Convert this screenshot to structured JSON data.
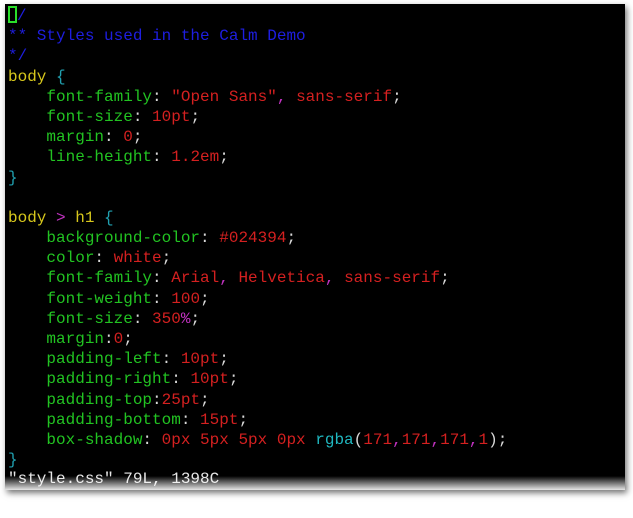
{
  "colors": {
    "background": "#000000",
    "comment": "#1e1ee0",
    "selector": "#d7c71c",
    "brace": "#20a0b0",
    "combinator": "#c032c0",
    "property": "#22c322",
    "value": "#d42020",
    "punct": "#d9d9d9",
    "function": "#20b8c0",
    "cursor": "#2adf2a",
    "status": "#e6e6e6"
  },
  "editor": {
    "lines": [
      {
        "kind": "cursor",
        "tokens": [
          {
            "t": "/",
            "c": "comment"
          }
        ]
      },
      {
        "tokens": [
          {
            "t": "** Styles used in the Calm Demo",
            "c": "comment"
          }
        ]
      },
      {
        "tokens": [
          {
            "t": "*/",
            "c": "comment"
          }
        ]
      },
      {
        "tokens": [
          {
            "t": "body",
            "c": "selector"
          },
          {
            "t": " ",
            "c": "punct"
          },
          {
            "t": "{",
            "c": "brace"
          }
        ]
      },
      {
        "tokens": [
          {
            "t": "    ",
            "c": "punct"
          },
          {
            "t": "font-family",
            "c": "property"
          },
          {
            "t": ": ",
            "c": "punct"
          },
          {
            "t": "\"Open Sans\"",
            "c": "value"
          },
          {
            "t": ", ",
            "c": "combinator"
          },
          {
            "t": "sans-serif",
            "c": "value"
          },
          {
            "t": ";",
            "c": "punct"
          }
        ]
      },
      {
        "tokens": [
          {
            "t": "    ",
            "c": "punct"
          },
          {
            "t": "font-size",
            "c": "property"
          },
          {
            "t": ": ",
            "c": "punct"
          },
          {
            "t": "10pt",
            "c": "value"
          },
          {
            "t": ";",
            "c": "punct"
          }
        ]
      },
      {
        "tokens": [
          {
            "t": "    ",
            "c": "punct"
          },
          {
            "t": "margin",
            "c": "property"
          },
          {
            "t": ": ",
            "c": "punct"
          },
          {
            "t": "0",
            "c": "value"
          },
          {
            "t": ";",
            "c": "punct"
          }
        ]
      },
      {
        "tokens": [
          {
            "t": "    ",
            "c": "punct"
          },
          {
            "t": "line-height",
            "c": "property"
          },
          {
            "t": ": ",
            "c": "punct"
          },
          {
            "t": "1.2em",
            "c": "value"
          },
          {
            "t": ";",
            "c": "punct"
          }
        ]
      },
      {
        "tokens": [
          {
            "t": "}",
            "c": "brace"
          }
        ]
      },
      {
        "tokens": []
      },
      {
        "tokens": [
          {
            "t": "body",
            "c": "selector"
          },
          {
            "t": " > ",
            "c": "combinator"
          },
          {
            "t": "h1",
            "c": "selector"
          },
          {
            "t": " ",
            "c": "punct"
          },
          {
            "t": "{",
            "c": "brace"
          }
        ]
      },
      {
        "tokens": [
          {
            "t": "    ",
            "c": "punct"
          },
          {
            "t": "background-color",
            "c": "property"
          },
          {
            "t": ": ",
            "c": "punct"
          },
          {
            "t": "#024394",
            "c": "value"
          },
          {
            "t": ";",
            "c": "punct"
          }
        ]
      },
      {
        "tokens": [
          {
            "t": "    ",
            "c": "punct"
          },
          {
            "t": "color",
            "c": "property"
          },
          {
            "t": ": ",
            "c": "punct"
          },
          {
            "t": "white",
            "c": "value"
          },
          {
            "t": ";",
            "c": "punct"
          }
        ]
      },
      {
        "tokens": [
          {
            "t": "    ",
            "c": "punct"
          },
          {
            "t": "font-family",
            "c": "property"
          },
          {
            "t": ": ",
            "c": "punct"
          },
          {
            "t": "Arial",
            "c": "value"
          },
          {
            "t": ", ",
            "c": "combinator"
          },
          {
            "t": "Helvetica",
            "c": "value"
          },
          {
            "t": ", ",
            "c": "combinator"
          },
          {
            "t": "sans-serif",
            "c": "value"
          },
          {
            "t": ";",
            "c": "punct"
          }
        ]
      },
      {
        "tokens": [
          {
            "t": "    ",
            "c": "punct"
          },
          {
            "t": "font-weight",
            "c": "property"
          },
          {
            "t": ": ",
            "c": "punct"
          },
          {
            "t": "100",
            "c": "value"
          },
          {
            "t": ";",
            "c": "punct"
          }
        ]
      },
      {
        "tokens": [
          {
            "t": "    ",
            "c": "punct"
          },
          {
            "t": "font-size",
            "c": "property"
          },
          {
            "t": ": ",
            "c": "punct"
          },
          {
            "t": "350",
            "c": "value"
          },
          {
            "t": "%",
            "c": "combinator"
          },
          {
            "t": ";",
            "c": "punct"
          }
        ]
      },
      {
        "tokens": [
          {
            "t": "    ",
            "c": "punct"
          },
          {
            "t": "margin",
            "c": "property"
          },
          {
            "t": ":",
            "c": "punct"
          },
          {
            "t": "0",
            "c": "value"
          },
          {
            "t": ";",
            "c": "punct"
          }
        ]
      },
      {
        "tokens": [
          {
            "t": "    ",
            "c": "punct"
          },
          {
            "t": "padding-left",
            "c": "property"
          },
          {
            "t": ": ",
            "c": "punct"
          },
          {
            "t": "10pt",
            "c": "value"
          },
          {
            "t": ";",
            "c": "punct"
          }
        ]
      },
      {
        "tokens": [
          {
            "t": "    ",
            "c": "punct"
          },
          {
            "t": "padding-right",
            "c": "property"
          },
          {
            "t": ": ",
            "c": "punct"
          },
          {
            "t": "10pt",
            "c": "value"
          },
          {
            "t": ";",
            "c": "punct"
          }
        ]
      },
      {
        "tokens": [
          {
            "t": "    ",
            "c": "punct"
          },
          {
            "t": "padding-top",
            "c": "property"
          },
          {
            "t": ":",
            "c": "punct"
          },
          {
            "t": "25pt",
            "c": "value"
          },
          {
            "t": ";",
            "c": "punct"
          }
        ]
      },
      {
        "tokens": [
          {
            "t": "    ",
            "c": "punct"
          },
          {
            "t": "padding-bottom",
            "c": "property"
          },
          {
            "t": ": ",
            "c": "punct"
          },
          {
            "t": "15pt",
            "c": "value"
          },
          {
            "t": ";",
            "c": "punct"
          }
        ]
      },
      {
        "tokens": [
          {
            "t": "    ",
            "c": "punct"
          },
          {
            "t": "box-shadow",
            "c": "property"
          },
          {
            "t": ": ",
            "c": "punct"
          },
          {
            "t": "0px 5px 5px 0px ",
            "c": "value"
          },
          {
            "t": "rgba",
            "c": "function"
          },
          {
            "t": "(",
            "c": "punct"
          },
          {
            "t": "171",
            "c": "value"
          },
          {
            "t": ",",
            "c": "combinator"
          },
          {
            "t": "171",
            "c": "value"
          },
          {
            "t": ",",
            "c": "combinator"
          },
          {
            "t": "171",
            "c": "value"
          },
          {
            "t": ",",
            "c": "combinator"
          },
          {
            "t": "1",
            "c": "value"
          },
          {
            "t": ");",
            "c": "punct"
          }
        ]
      },
      {
        "tokens": [
          {
            "t": "}",
            "c": "brace"
          }
        ]
      }
    ]
  },
  "status_line": {
    "text": "\"style.css\" 79L, 1398C"
  }
}
